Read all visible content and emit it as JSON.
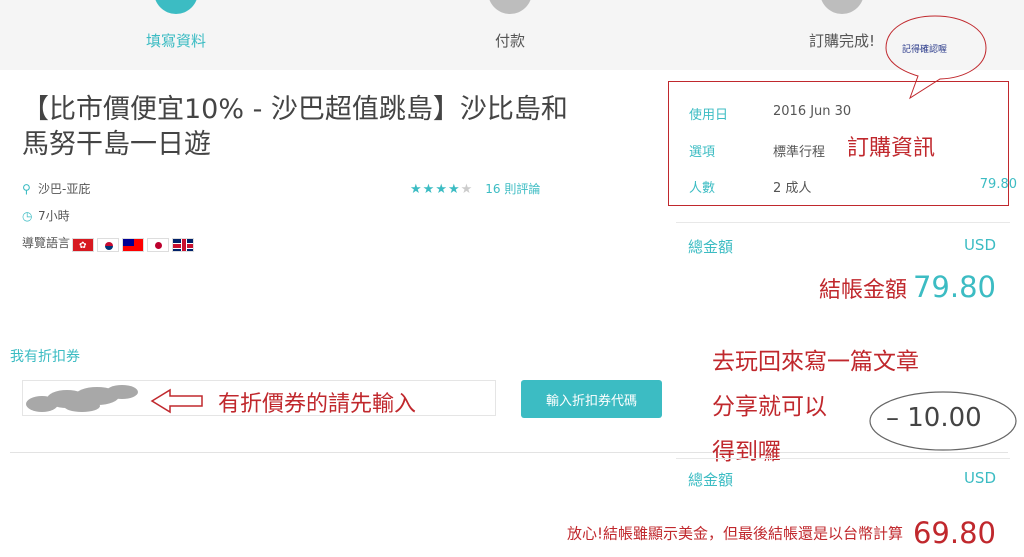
{
  "steps": [
    {
      "label": "填寫資料",
      "active": true
    },
    {
      "label": "付款",
      "active": false
    },
    {
      "label": "訂購完成!",
      "active": false
    }
  ],
  "product": {
    "title": "【比市價便宜10% - 沙巴超值跳島】沙比島和馬努干島一日遊",
    "location": "沙巴-亚庇",
    "duration": "7小時",
    "guide_language_label": "導覽語言",
    "rating_stars": 4,
    "rating_max": 5,
    "review_count": "16 則評論"
  },
  "coupon": {
    "label": "我有折扣券",
    "input_value": "",
    "button_label": "輸入折扣券代碼"
  },
  "order": {
    "date_label": "使用日",
    "date_value": "2016 Jun 30",
    "option_label": "選項",
    "option_value": "標準行程",
    "people_label": "人數",
    "people_value": "2 成人",
    "people_price": "79.80"
  },
  "totals": {
    "total_label": "總金額",
    "currency": "USD",
    "checkout_label": "結帳金額",
    "checkout_value": "79.80",
    "discount_value": "– 10.00",
    "total_label_2": "總金額",
    "currency_2": "USD",
    "final_value": "69.80"
  },
  "annotations": {
    "confirm": "記得確認喔",
    "order_info": "訂購資訊",
    "coupon_hint": "有折價券的請先輸入",
    "share_line1": "去玩回來寫一篇文章",
    "share_line2": "分享就可以",
    "share_line3": "得到囉",
    "final_note": "放心!結帳雖顯示美金，但最後結帳還是以台幣計算"
  },
  "colors": {
    "accent": "#3cbcc3",
    "annotation": "#c0282d"
  }
}
